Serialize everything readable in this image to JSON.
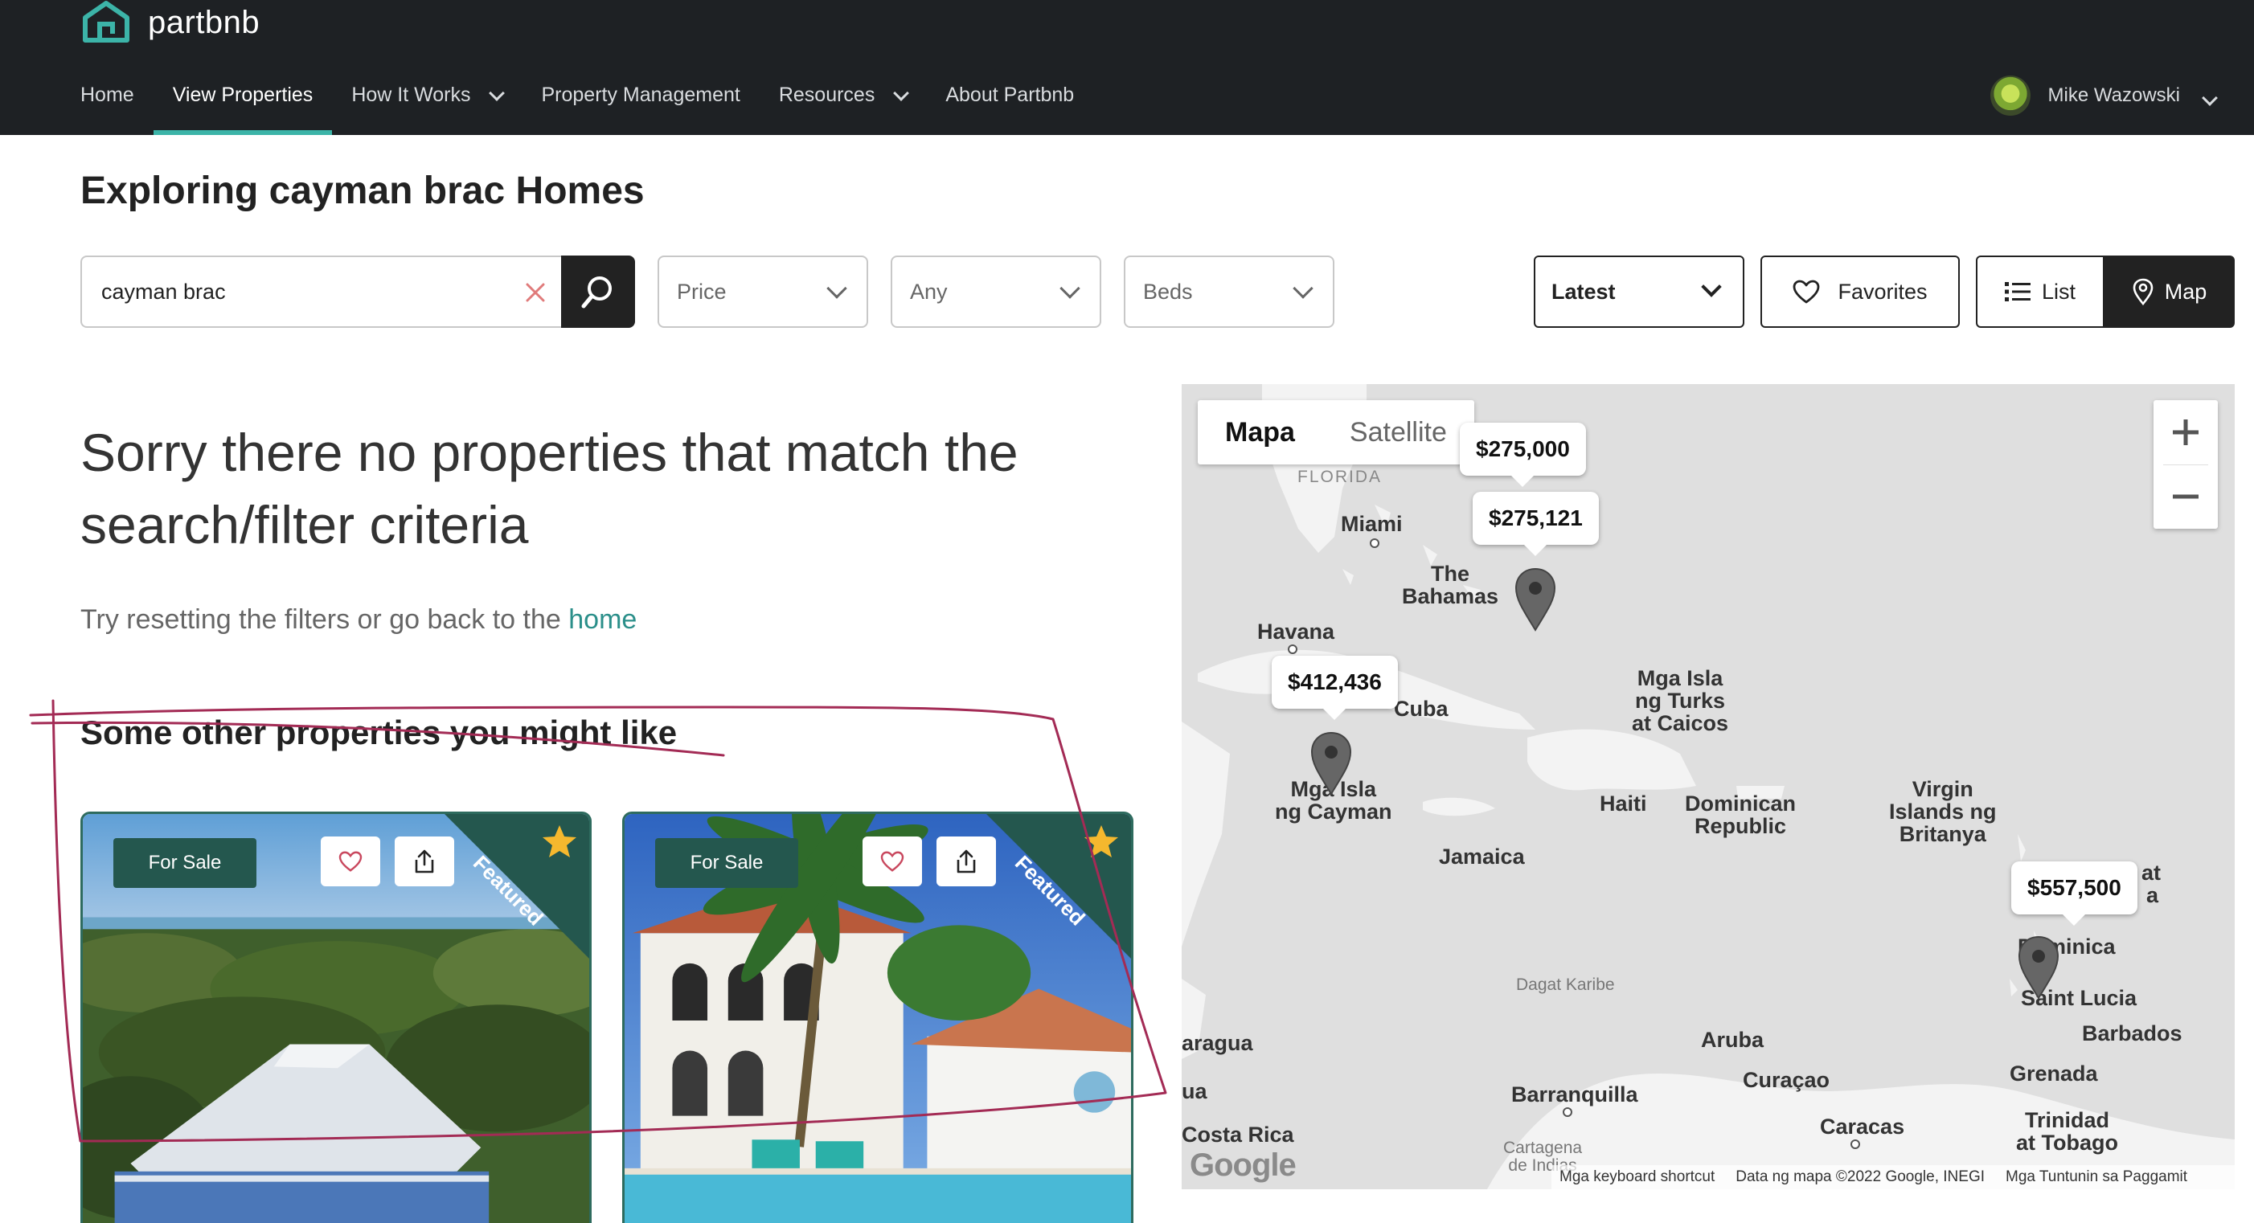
{
  "brand": {
    "name": "partbnb",
    "accent": "#3cb4a8",
    "dark": "#1e2124",
    "green": "#24574e"
  },
  "nav": {
    "items": [
      {
        "label": "Home"
      },
      {
        "label": "View Properties"
      },
      {
        "label": "How It Works"
      },
      {
        "label": "Property Management"
      },
      {
        "label": "Resources"
      },
      {
        "label": "About Partbnb"
      }
    ],
    "user": {
      "name": "Mike Wazowski"
    }
  },
  "page": {
    "title": "Exploring cayman brac Homes"
  },
  "search": {
    "value": "cayman brac",
    "placeholder": ""
  },
  "filters": {
    "price": "Price",
    "type": "Any",
    "beds": "Beds"
  },
  "sort": {
    "value": "Latest"
  },
  "actions": {
    "favorites": "Favorites",
    "list": "List",
    "map": "Map"
  },
  "empty": {
    "title": "Sorry there no properties that match the search/filter criteria",
    "hint_prefix": "Try resetting the filters or go back to the ",
    "hint_link": "home"
  },
  "other": {
    "title": "Some other properties you might like",
    "cards": [
      {
        "status": "For Sale",
        "ribbon": "Featured"
      },
      {
        "status": "For Sale",
        "ribbon": "Featured"
      }
    ]
  },
  "map": {
    "type_options": [
      "Mapa",
      "Satellite"
    ],
    "prices": [
      "$275,000",
      "$275,121",
      "$412,436",
      "$557,500"
    ],
    "places": {
      "florida": "FLORIDA",
      "miami": "Miami",
      "bahamas": "The\nBahamas",
      "havana": "Havana",
      "cuba": "Cuba",
      "turks": "Mga Isla\nng Turks\nat Caicos",
      "cayman": "Mga Isla\nng Cayman",
      "haiti": "Haiti",
      "dominican": "Dominican\nRepublic",
      "virgin": "Virgin\nIslands ng\nBritanya",
      "jamaica": "Jamaica",
      "caribbean": "Dagat Karibe",
      "dominica": "Dominica",
      "stlucia": "Saint Lucia",
      "barbados": "Barbados",
      "grenada": "Grenada",
      "aruba": "Aruba",
      "curacao": "Curaçao",
      "nicaragua": "aragua",
      "barranquilla": "Barranquilla",
      "caracas": "Caracas",
      "costarica": "Costa Rica",
      "cartagena": "Cartagena\nde Indias",
      "trinidad": "Trinidad\nat Tobago",
      "ua": "ua",
      "at": "at",
      "a": "a"
    },
    "google": "Google",
    "attribution": {
      "shortcuts": "Mga keyboard shortcut",
      "data": "Data ng mapa ©2022 Google, INEGI",
      "terms": "Mga Tuntunin sa Paggamit"
    }
  }
}
